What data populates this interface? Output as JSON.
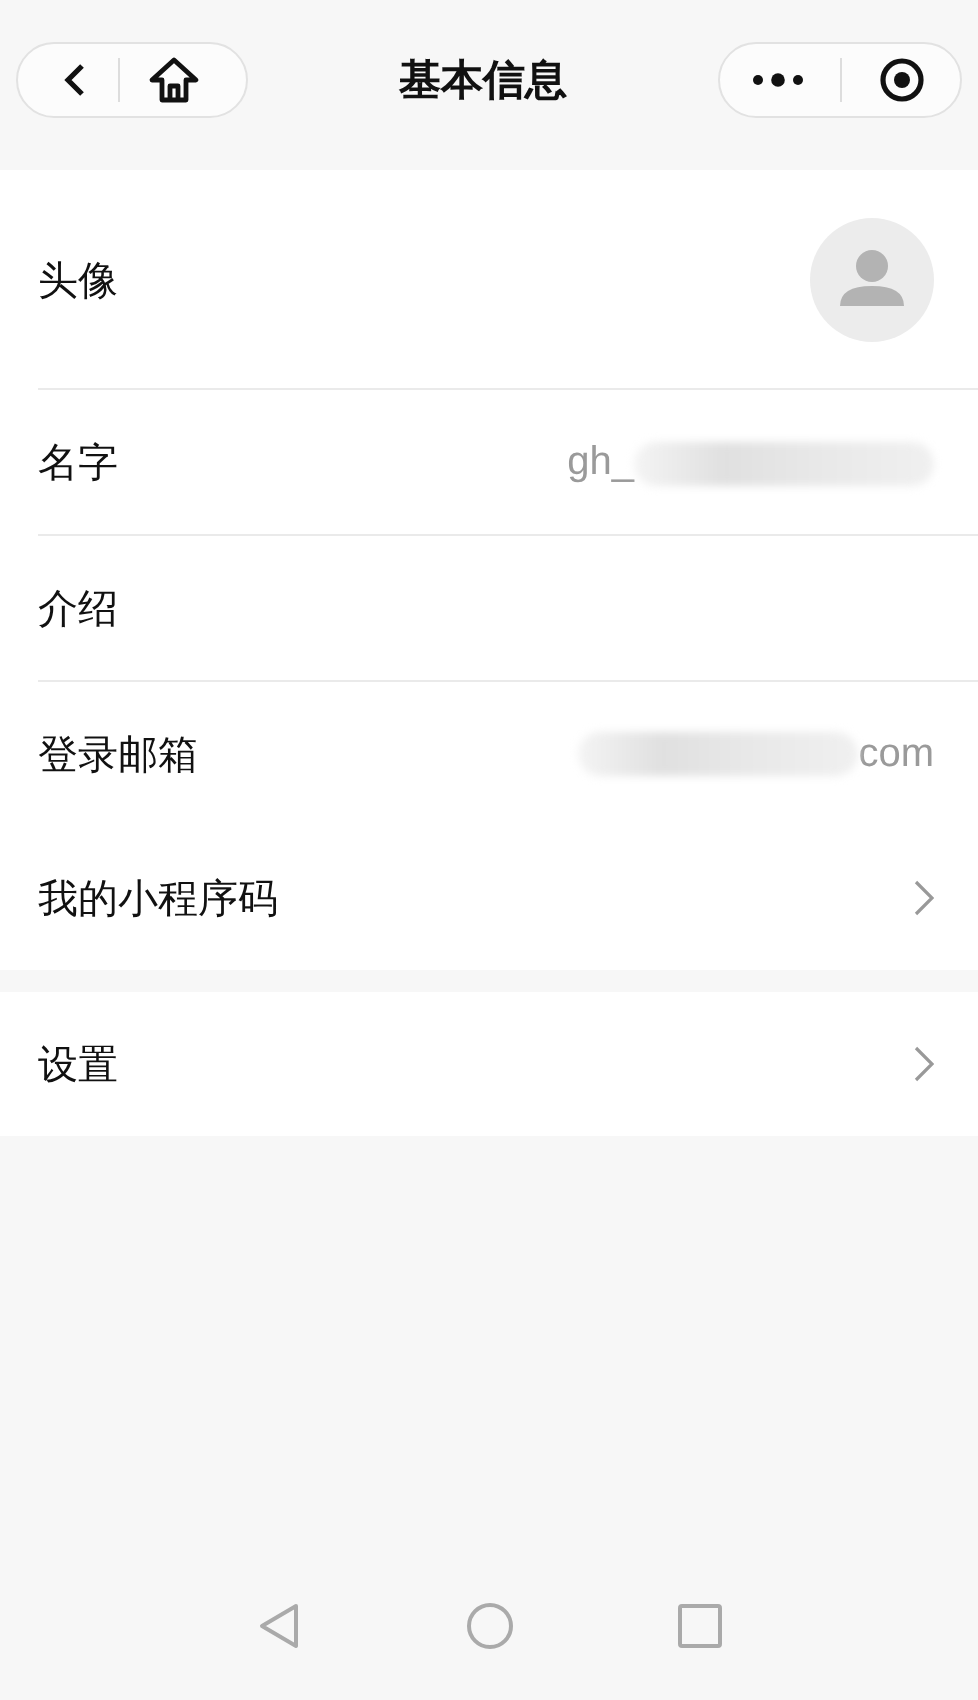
{
  "header": {
    "title": "基本信息"
  },
  "sections": [
    {
      "rows": [
        {
          "kind": "avatar",
          "label": "头像",
          "divider": true
        },
        {
          "kind": "value",
          "label": "名字",
          "value": "gh_",
          "redacted": true,
          "divider": true
        },
        {
          "kind": "value",
          "label": "介绍",
          "divider": true
        },
        {
          "kind": "value",
          "label": "登录邮箱",
          "value": "com",
          "redacted": true,
          "divider": false
        },
        {
          "kind": "arrow",
          "label": "我的小程序码",
          "divider": false
        }
      ]
    },
    {
      "rows": [
        {
          "kind": "arrow",
          "label": "设置",
          "divider": false
        }
      ]
    }
  ]
}
